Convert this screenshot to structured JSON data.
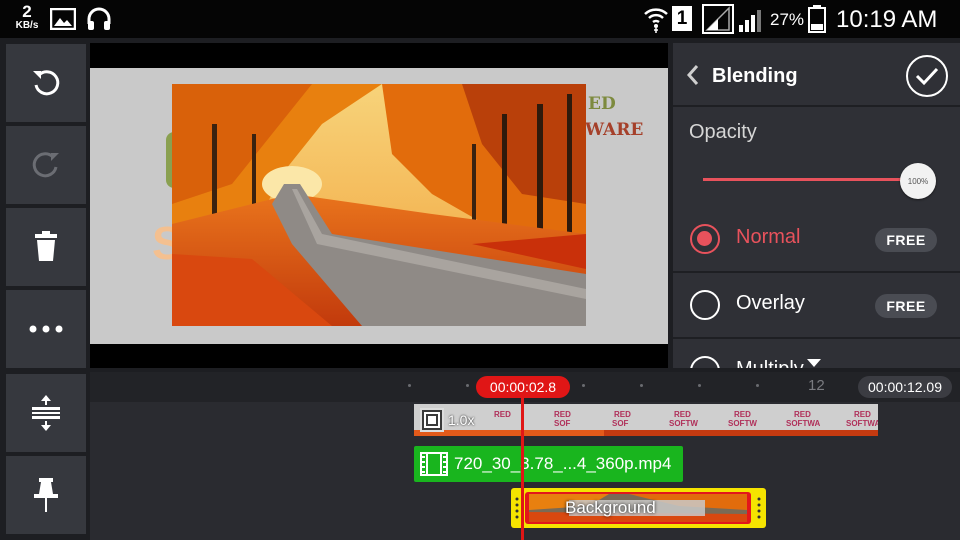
{
  "status_bar": {
    "speed_value": "2",
    "speed_unit": "KB/s",
    "sim_slot": "1",
    "battery": "27%",
    "time": "10:19 AM"
  },
  "preview": {
    "watermark_top": "ED",
    "watermark_bottom": "WARE"
  },
  "blending_panel": {
    "title": "Blending",
    "opacity_label": "Opacity",
    "opacity_value": "100%",
    "opacity_fraction": 1.0,
    "modes": [
      {
        "label": "Normal",
        "badge": "FREE",
        "selected": true
      },
      {
        "label": "Overlay",
        "badge": "FREE",
        "selected": false
      },
      {
        "label": "Multiply",
        "badge": "",
        "selected": false
      }
    ]
  },
  "timeline": {
    "current_time": "00:00:02.8",
    "duration": "00:00:12.09",
    "tick_label": "12",
    "main_track_speed": "1.0x",
    "video_clip_name": "720_30_3.78_...4_360p.mp4",
    "background_clip_name": "Background"
  },
  "colors": {
    "accent": "#e8525c",
    "playhead": "#e01616",
    "video_clip": "#19b51e",
    "layer_clip": "#f5e400"
  }
}
